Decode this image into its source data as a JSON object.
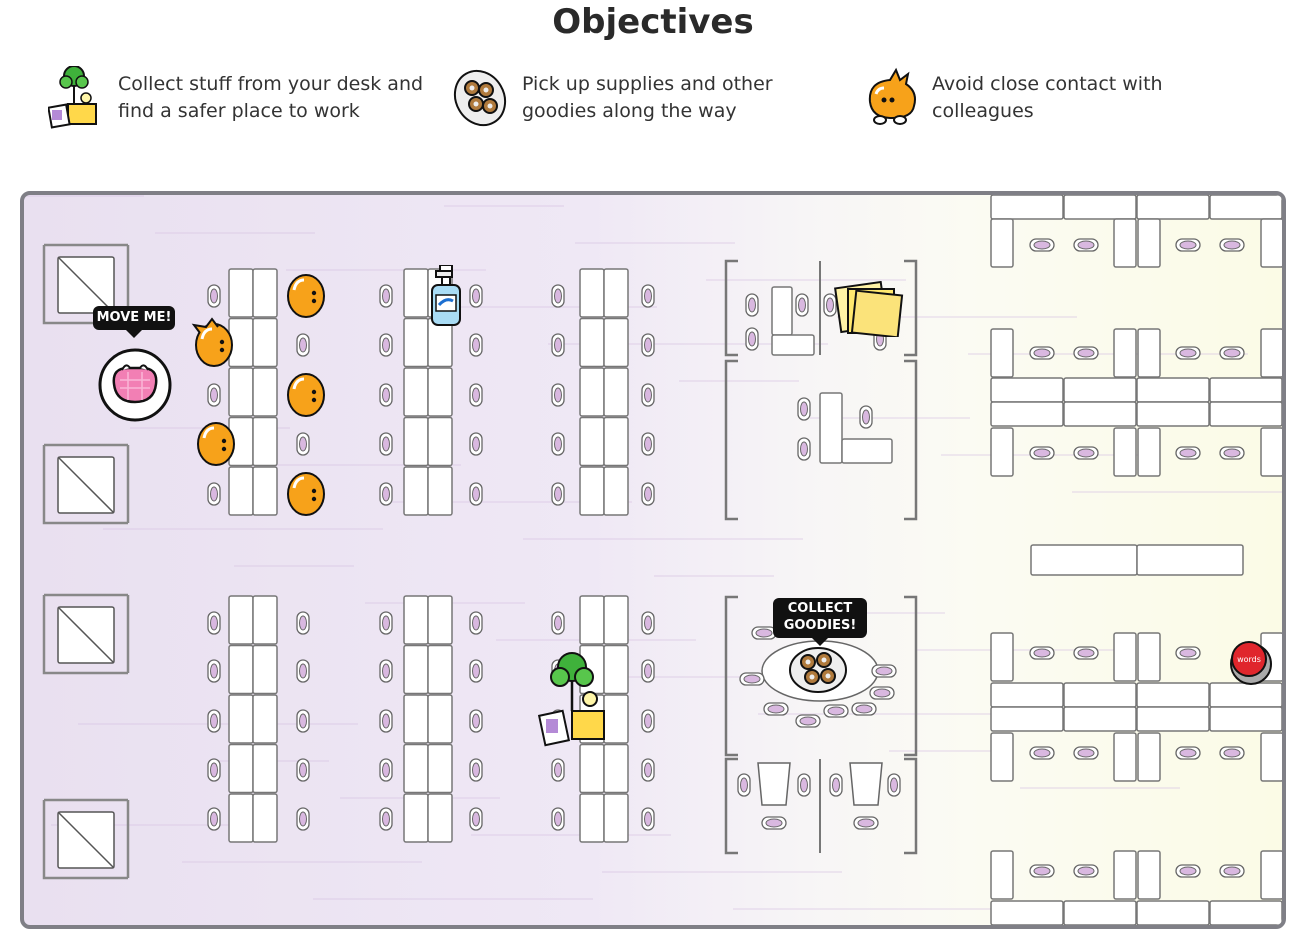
{
  "page": {
    "title": "Objectives"
  },
  "objectives": [
    {
      "icon": "desk-items-icon",
      "text": "Collect stuff from your desk and find a safer place to work"
    },
    {
      "icon": "donuts-icon",
      "text": "Pick up supplies and other goodies along the way"
    },
    {
      "icon": "colleague-blob-icon",
      "text": "Avoid close contact with colleagues"
    }
  ],
  "game": {
    "move_hint": "MOVE ME!",
    "collect_hint_line1": "COLLECT",
    "collect_hint_line2": "GOODIES!",
    "button_label": "words"
  },
  "colors": {
    "colleague": "#f7a21a",
    "player": "#f27fb4",
    "chair": "#d9b8e0",
    "board_border": "#7f7f86",
    "button": "#e0262c"
  }
}
